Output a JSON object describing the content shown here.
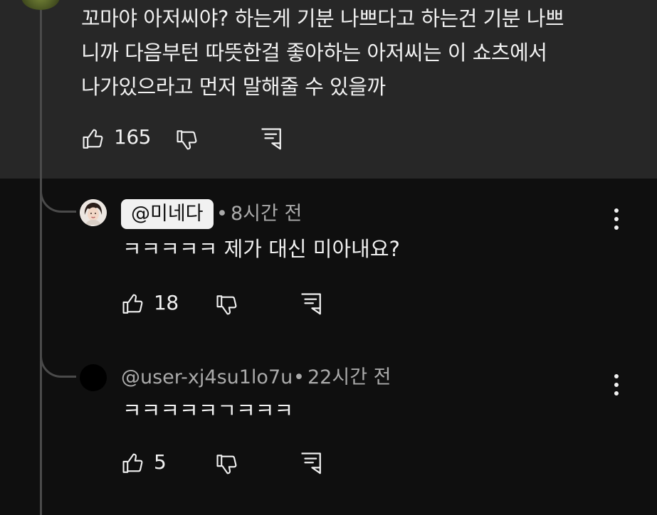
{
  "parent_comment": {
    "text_lines": [
      "꼬마야 아저씨야? 하는게 기분 나쁘다고 하는건 기분 나쁘",
      "니까 다음부턴 따뜻한걸 좋아하는 아저씨는 이 쇼츠에서",
      "나가있으라고 먼저 말해줄 수 있을까"
    ],
    "like_count": "165"
  },
  "replies": [
    {
      "handle": "@미네다",
      "separator": "•",
      "time": "8시간 전",
      "text": "ㅋㅋㅋㅋㅋ 제가 대신 미아내요?",
      "like_count": "18"
    },
    {
      "handle": "@user-xj4su1lo7u",
      "separator": "•",
      "time": "22시간 전",
      "text": "ㅋㅋㅋㅋㅋㄱㅋㅋㅋ",
      "like_count": "5"
    }
  ],
  "icons": {
    "like": "thumbs-up-icon",
    "dislike": "thumbs-down-icon",
    "reply": "reply-comment-icon",
    "more": "more-vertical-icon"
  },
  "colors": {
    "background": "#0f0f0f",
    "parent_highlight": "#272727",
    "text_primary": "#f1f1f1",
    "text_secondary": "#aaaaaa",
    "thread_line": "#4a4a4a"
  }
}
